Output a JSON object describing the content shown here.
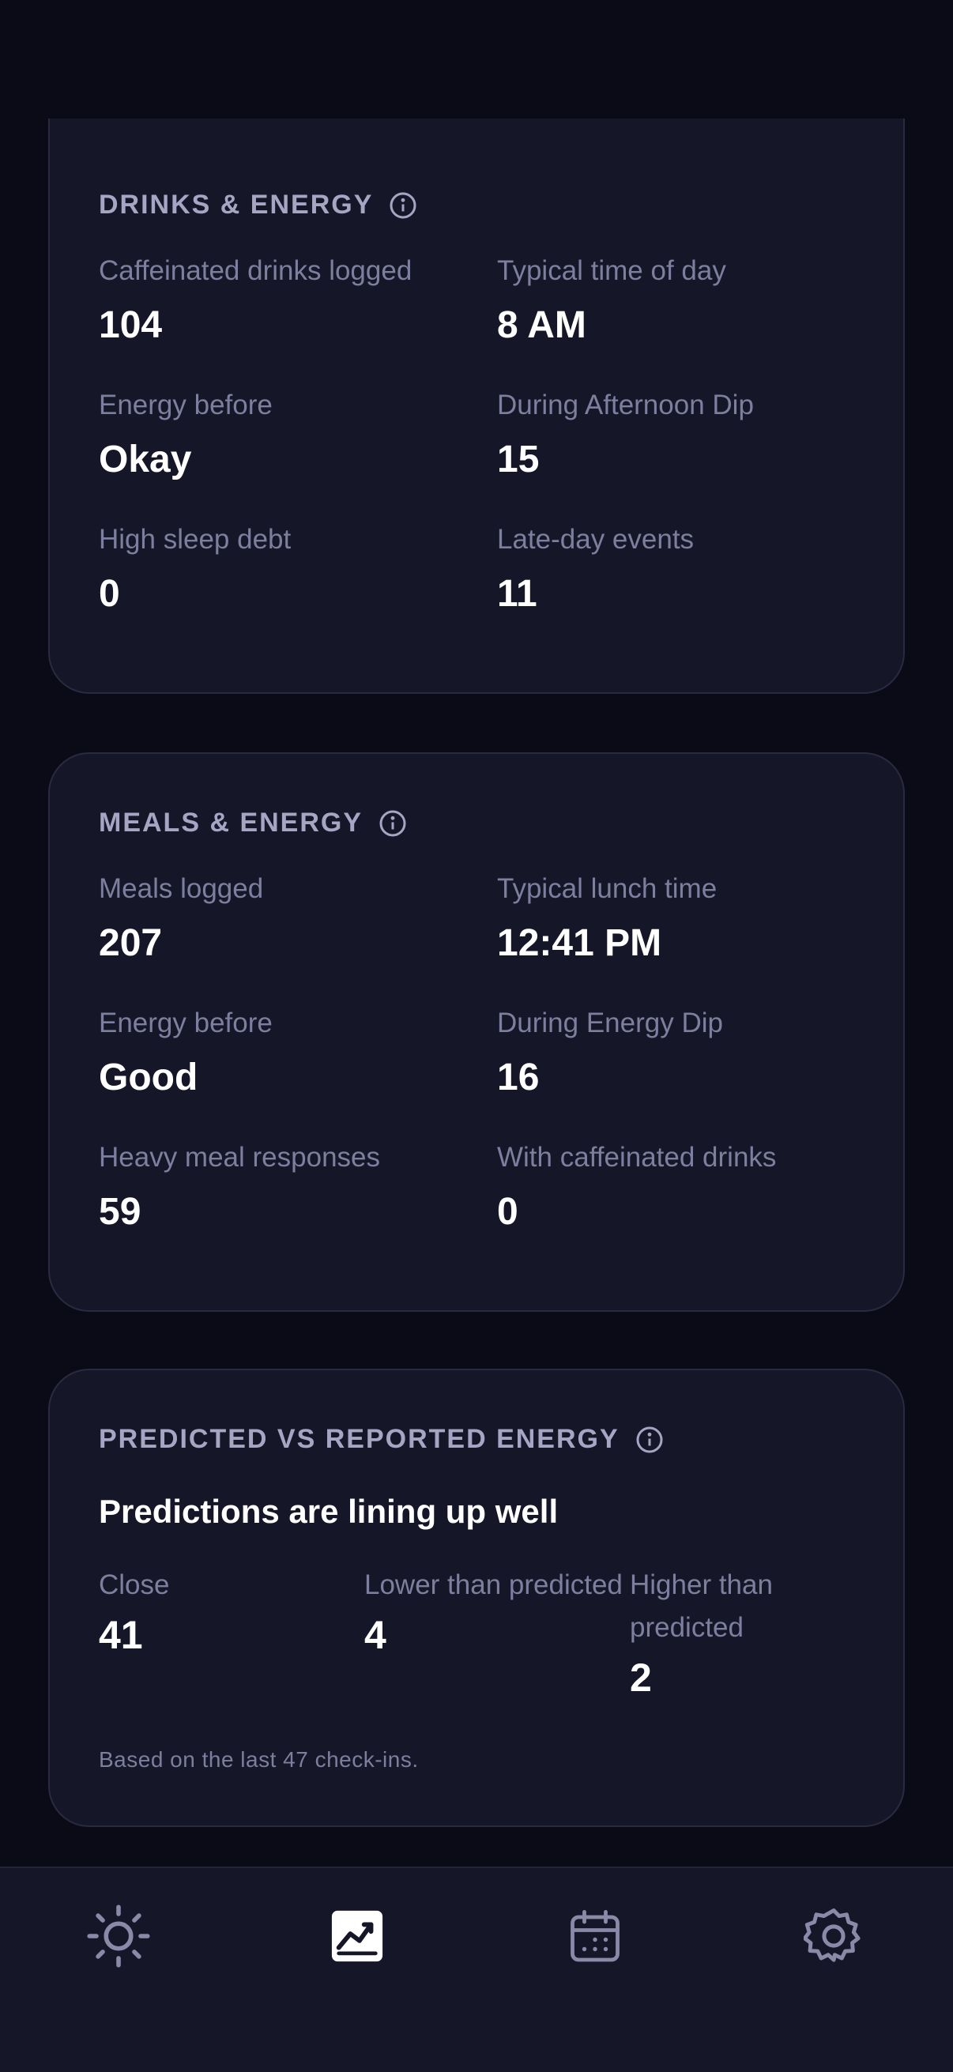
{
  "drinks_card": {
    "title": "DRINKS & ENERGY",
    "stats": [
      {
        "label": "Caffeinated drinks logged",
        "value": "104"
      },
      {
        "label": "Typical time of day",
        "value": "8 AM"
      },
      {
        "label": "Energy before",
        "value": "Okay"
      },
      {
        "label": "During Afternoon Dip",
        "value": "15"
      },
      {
        "label": "High sleep debt",
        "value": "0"
      },
      {
        "label": "Late-day events",
        "value": "11"
      }
    ]
  },
  "meals_card": {
    "title": "MEALS & ENERGY",
    "stats": [
      {
        "label": "Meals logged",
        "value": "207"
      },
      {
        "label": "Typical lunch time",
        "value": "12:41 PM"
      },
      {
        "label": "Energy before",
        "value": "Good"
      },
      {
        "label": "During Energy Dip",
        "value": "16"
      },
      {
        "label": "Heavy meal responses",
        "value": "59"
      },
      {
        "label": "With caffeinated drinks",
        "value": "0"
      }
    ]
  },
  "prediction_card": {
    "title": "PREDICTED VS REPORTED ENERGY",
    "headline": "Predictions are lining up well",
    "stats": [
      {
        "label": "Close",
        "value": "41"
      },
      {
        "label": "Lower than predicted",
        "value": "4"
      },
      {
        "label": "Higher than predicted",
        "value": "2"
      }
    ],
    "footnote": "Based on the last 47 check-ins."
  },
  "nav": {
    "items": [
      {
        "icon": "sun-icon",
        "active": false
      },
      {
        "icon": "chart-icon",
        "active": true
      },
      {
        "icon": "calendar-icon",
        "active": false
      },
      {
        "icon": "gear-icon",
        "active": false
      }
    ]
  },
  "colors": {
    "background": "#0b0b17",
    "card": "#161629",
    "label": "#7e7e9e",
    "title": "#a6a6c4",
    "nav_active": "#ffffff",
    "nav_inactive": "#8a8aa8"
  }
}
